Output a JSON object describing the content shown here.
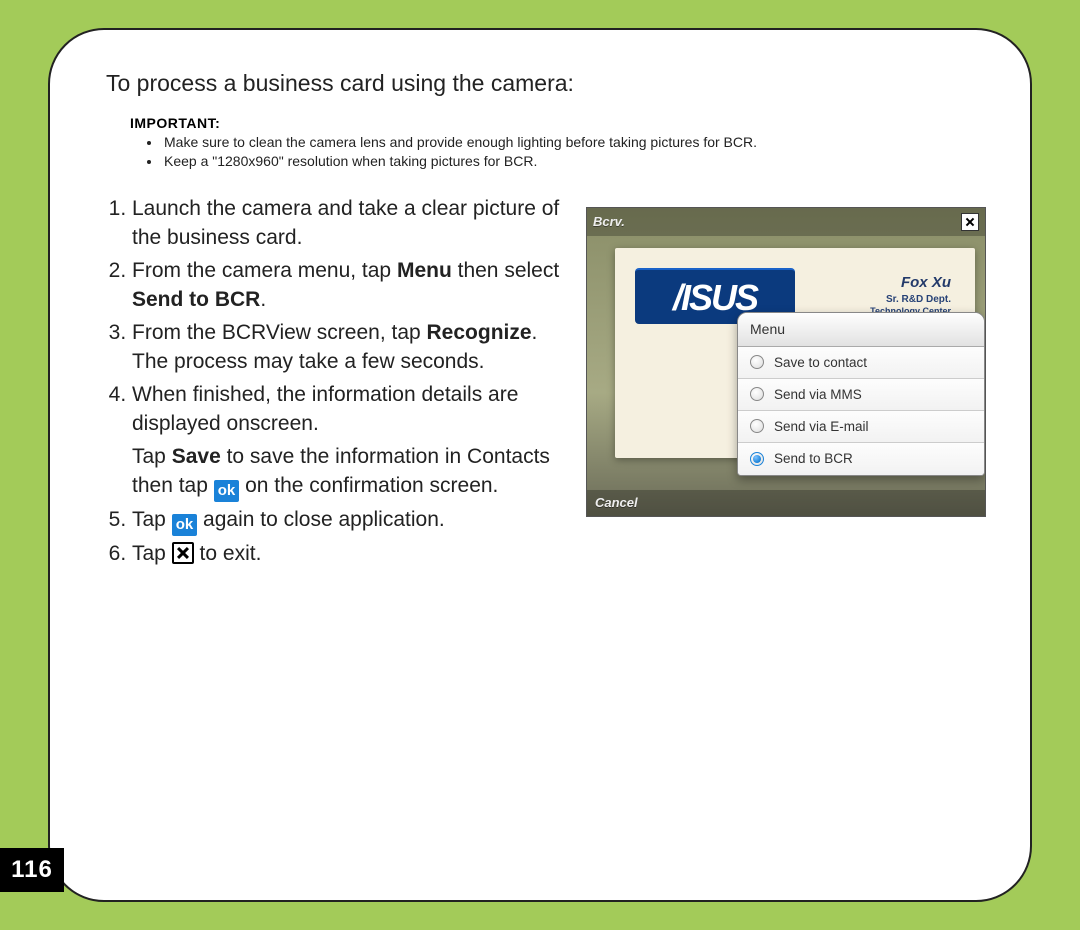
{
  "heading": "To process a business card using the camera:",
  "important": {
    "label": "IMPORTANT:",
    "items": [
      "Make sure to clean the camera lens and provide enough lighting before taking pictures for BCR.",
      "Keep a \"1280x960\" resolution when taking pictures for BCR."
    ]
  },
  "steps": {
    "s1": "Launch the camera and take a clear picture of the business card.",
    "s2a": "From the camera menu, tap ",
    "s2b": "Menu",
    "s2c": " then select ",
    "s2d": "Send to BCR",
    "s2e": ".",
    "s3a": "From the BCRView screen, tap ",
    "s3b": "Recognize",
    "s3c": ". The process may take a few seconds.",
    "s4": "When finished, the information details are displayed onscreen.",
    "s4xa": "Tap ",
    "s4xb": "Save",
    "s4xc": " to save the information in Contacts then tap ",
    "s4xd": " on the confirmation screen.",
    "s5a": "Tap ",
    "s5b": " again to close application.",
    "s6a": "Tap  ",
    "s6b": "  to exit."
  },
  "ok_label": "ok",
  "screenshot": {
    "topbar_title": "Bcrv.",
    "card_logo": "/ISUS",
    "card_name": "Fox Xu",
    "card_sub1": "Sr. R&D Dept.",
    "card_sub2": "Technology Center",
    "menu_title": "Menu",
    "menu_items": [
      "Save to contact",
      "Send via MMS",
      "Send via E-mail",
      "Send to BCR"
    ],
    "selected_index": 3,
    "bottom_label": "Cancel"
  },
  "page_number": "116"
}
